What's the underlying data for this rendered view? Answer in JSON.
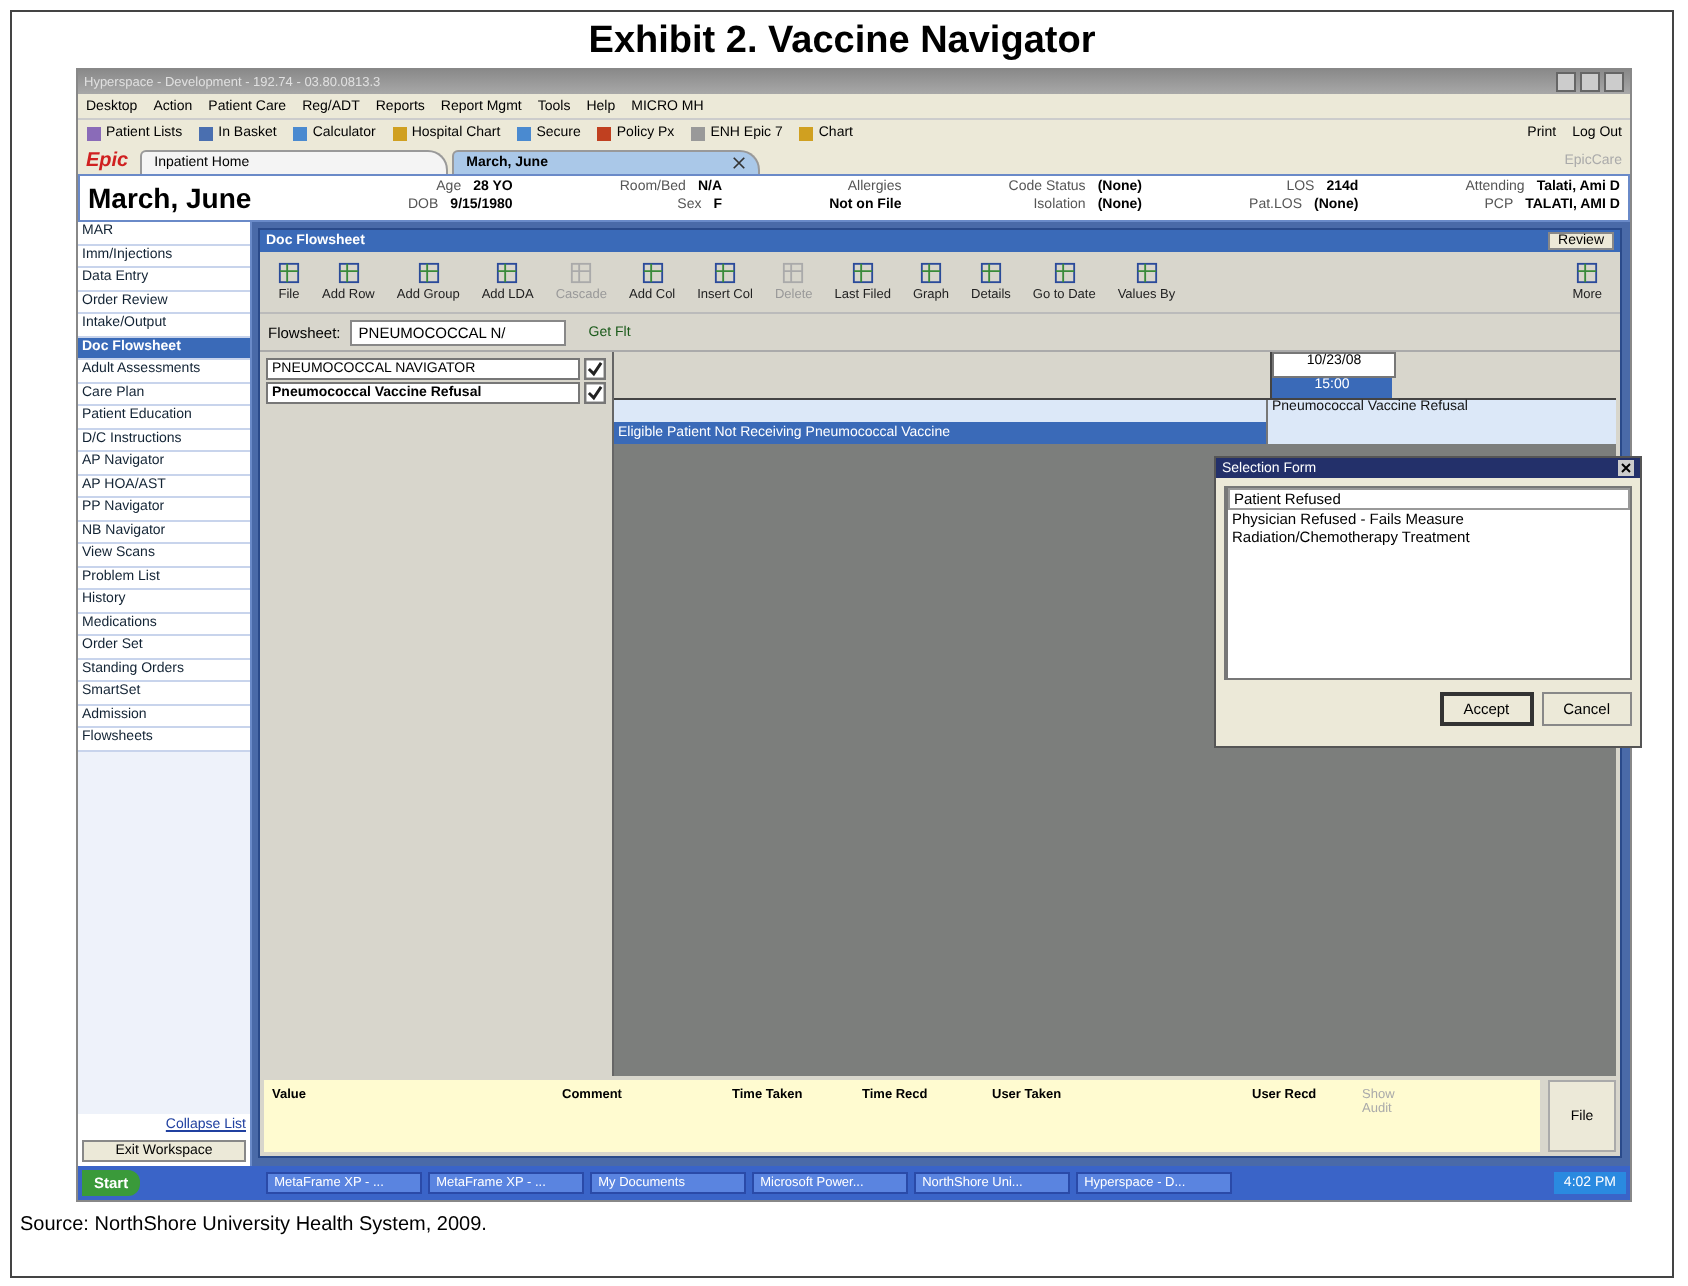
{
  "exhibit_title": "Exhibit 2. Vaccine Navigator",
  "window": {
    "title": "Hyperspace - Development - 192.74 - 03.80.0813.3"
  },
  "menu": [
    "Desktop",
    "Action",
    "Patient Care",
    "Reg/ADT",
    "Reports",
    "Report Mgmt",
    "Tools",
    "Help",
    "MICRO MH"
  ],
  "toolbar": [
    "Patient Lists",
    "In Basket",
    "Calculator",
    "Hospital Chart",
    "Secure",
    "Policy Px",
    "ENH Epic 7",
    "Chart"
  ],
  "toolbar_right": [
    "Print",
    "Log Out"
  ],
  "logo": "Epic",
  "tabs": [
    {
      "label": "Inpatient Home",
      "selected": false
    },
    {
      "label": "March, June",
      "selected": true
    }
  ],
  "tabs_right": "EpicCare",
  "patient": {
    "name": "March, June",
    "columns": [
      {
        "items": [
          {
            "label": "Age",
            "value": "28 YO"
          },
          {
            "label": "DOB",
            "value": "9/15/1980"
          }
        ]
      },
      {
        "items": [
          {
            "label": "Room/Bed",
            "value": "N/A"
          },
          {
            "label": "Sex",
            "value": "F"
          }
        ]
      },
      {
        "items": [
          {
            "label": "Allergies"
          },
          {
            "value": "Not on File"
          }
        ]
      },
      {
        "items": [
          {
            "label": "Code Status",
            "value": "(None)"
          },
          {
            "label": "Isolation",
            "value": "(None)"
          }
        ]
      },
      {
        "items": [
          {
            "label": "LOS",
            "value": "214d"
          },
          {
            "label": "Pat.LOS",
            "value": "(None)"
          }
        ]
      },
      {
        "items": [
          {
            "label": "Attending",
            "value": "Talati, Ami D"
          },
          {
            "label": "PCP",
            "value": "TALATI, AMI D"
          }
        ]
      }
    ]
  },
  "sidebar": {
    "items": [
      {
        "label": "MAR",
        "selected": false
      },
      {
        "label": "Imm/Injections",
        "selected": false
      },
      {
        "label": "Data Entry",
        "selected": false
      },
      {
        "label": "Order Review",
        "selected": false
      },
      {
        "label": "Intake/Output",
        "selected": false
      },
      {
        "label": "Doc Flowsheet",
        "selected": true
      },
      {
        "label": "Adult Assessments",
        "selected": false
      },
      {
        "label": "Care Plan",
        "selected": false
      },
      {
        "label": "Patient Education",
        "selected": false
      },
      {
        "label": "D/C Instructions",
        "selected": false
      },
      {
        "label": "AP Navigator",
        "selected": false
      },
      {
        "label": "AP HOA/AST",
        "selected": false
      },
      {
        "label": "PP Navigator",
        "selected": false
      },
      {
        "label": "NB Navigator",
        "selected": false
      },
      {
        "label": "View Scans",
        "selected": false
      },
      {
        "label": "Problem List",
        "selected": false
      },
      {
        "label": "History",
        "selected": false
      },
      {
        "label": "Medications",
        "selected": false
      },
      {
        "label": "Order Set",
        "selected": false
      },
      {
        "label": "Standing Orders",
        "selected": false
      },
      {
        "label": "SmartSet",
        "selected": false
      },
      {
        "label": "Admission",
        "selected": false
      },
      {
        "label": "Flowsheets",
        "selected": false
      }
    ],
    "collapse": "Collapse List",
    "exit": "Exit Workspace"
  },
  "panel": {
    "title": "Doc Flowsheet",
    "review": "Review",
    "buttons": [
      {
        "label": "File",
        "disabled": false
      },
      {
        "label": "Add Row",
        "disabled": false
      },
      {
        "label": "Add Group",
        "disabled": false
      },
      {
        "label": "Add LDA",
        "disabled": false
      },
      {
        "label": "Cascade",
        "disabled": true
      },
      {
        "label": "Add Col",
        "disabled": false
      },
      {
        "label": "Insert Col",
        "disabled": false
      },
      {
        "label": "Delete",
        "disabled": true
      },
      {
        "label": "Last Filed",
        "disabled": false
      },
      {
        "label": "Graph",
        "disabled": false
      },
      {
        "label": "Details",
        "disabled": false
      },
      {
        "label": "Go to Date",
        "disabled": false
      },
      {
        "label": "Values By",
        "disabled": false
      },
      {
        "label": "More",
        "disabled": false
      }
    ],
    "flowsheet_label": "Flowsheet:",
    "flowsheet_value": "PNEUMOCOCCAL N/",
    "get_flt": "Get Flt",
    "groups": [
      {
        "label": "PNEUMOCOCCAL NAVIGATOR",
        "checked": true
      },
      {
        "label": "Pneumococcal Vaccine Refusal",
        "checked": true
      }
    ],
    "date": "10/23/08",
    "time": "15:00",
    "rows": [
      {
        "value": "Pneumococcal Vaccine Refusal",
        "selected": false
      },
      {
        "label": "Eligible Patient Not Receiving Pneumococcal Vaccine",
        "selected": true
      }
    ],
    "bottom_columns": [
      "Value",
      "Comment",
      "Time Taken",
      "Time Recd",
      "User Taken",
      "User Recd"
    ],
    "show_audit": "Show Audit",
    "file": "File"
  },
  "dialog": {
    "title": "Selection Form",
    "options": [
      {
        "label": "Patient Refused",
        "selected": true
      },
      {
        "label": "Physician Refused - Fails Measure",
        "selected": false
      },
      {
        "label": "Radiation/Chemotherapy Treatment",
        "selected": false
      }
    ],
    "buttons": [
      "Accept",
      "Cancel"
    ]
  },
  "taskbar": {
    "start": "Start",
    "tasks": [
      "MetaFrame XP - ...",
      "MetaFrame XP - ...",
      "My Documents",
      "Microsoft Power...",
      "NorthShore Uni...",
      "Hyperspace - D..."
    ],
    "clock": "4:02 PM"
  },
  "source": "Source: NorthShore University Health System, 2009."
}
